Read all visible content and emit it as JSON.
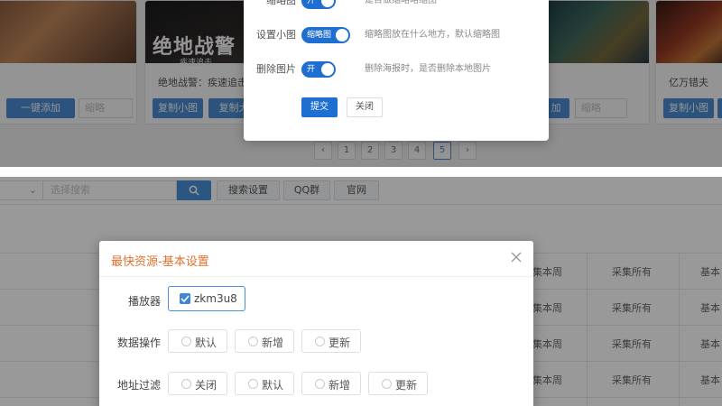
{
  "top": {
    "cards": [
      {
        "buttons": [
          "一键添加"
        ],
        "input_placeholder": "缩略"
      },
      {
        "thumb_title": "绝地战警",
        "thumb_sub": "疾速追击",
        "title": "绝地战警：疾速追击",
        "buttons": [
          "复制小图",
          "复制大"
        ]
      },
      {
        "buttons": [
          "加"
        ],
        "input_placeholder": "缩略"
      },
      {
        "title": "亿万错夫",
        "buttons": [
          "复制小图",
          "复制"
        ]
      }
    ],
    "pagination": [
      "‹",
      "1",
      "2",
      "3",
      "4",
      "5",
      "›"
    ],
    "pagination_active": "5",
    "dialog": {
      "rows": [
        {
          "label": "缩略图",
          "switch": "开",
          "desc": "是否做缩略略缩图"
        },
        {
          "label": "设置小图",
          "switch": "缩略图",
          "desc": "缩略图放在什么地方，默认缩略图"
        },
        {
          "label": "删除图片",
          "switch": "开",
          "desc": "删除海报时，是否删除本地图片"
        }
      ],
      "submit_label": "提交",
      "close_label": "关闭"
    }
  },
  "bottom": {
    "toolbar": {
      "search_placeholder": "选择搜索",
      "buttons": [
        "搜索设置",
        "QQ群",
        "官网"
      ]
    },
    "table": {
      "rows": [
        [
          "集本周",
          "采集所有",
          "基本"
        ],
        [
          "集本周",
          "采集所有",
          "基本"
        ],
        [
          "集本周",
          "采集所有",
          "基本"
        ],
        [
          "集本周",
          "采集所有",
          "基本"
        ]
      ]
    },
    "dialog": {
      "title": "最快资源-基本设置",
      "player_label": "播放器",
      "player_value": "zkm3u8",
      "data_op_label": "数据操作",
      "data_op_options": [
        "默认",
        "新增",
        "更新"
      ],
      "url_filter_label": "地址过滤",
      "url_filter_options": [
        "关闭",
        "默认",
        "新增",
        "更新"
      ]
    }
  },
  "colors": {
    "accent": "#4a90d9",
    "switch_on": "#1f6fd1",
    "dialog_title": "#e0702b"
  }
}
